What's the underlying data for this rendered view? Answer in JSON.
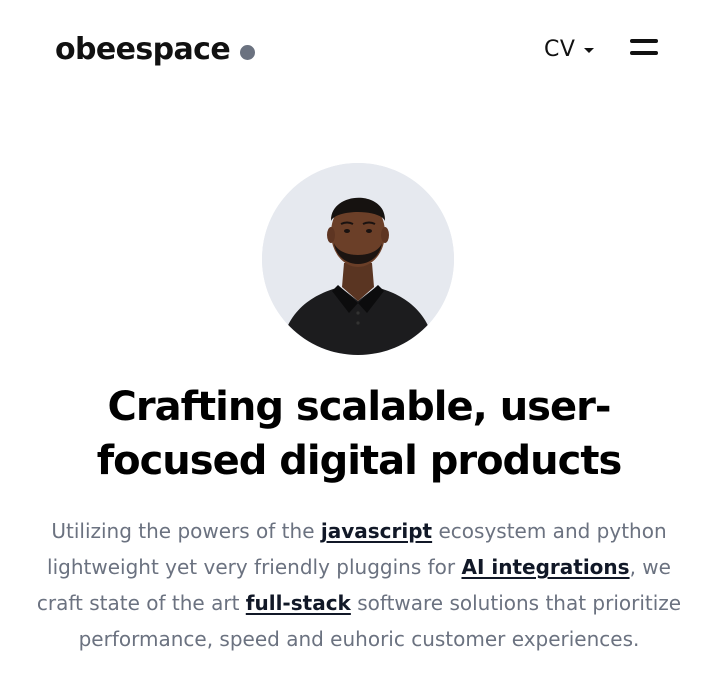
{
  "header": {
    "logo_text": "obeespace",
    "cv_label": "CV"
  },
  "hero": {
    "title": "Crafting scalable, user-focused digital products",
    "description": {
      "part1": "Utilizing the powers of the ",
      "link_javascript": "javascript",
      "part2": " ecosystem and python lightweight yet very friendly pluggins for ",
      "link_ai": "AI integrations",
      "part3": ", we craft state of the art ",
      "link_fullstack": "full-stack",
      "part4": " software solutions that prioritize performance, speed and euhoric customer experiences."
    }
  },
  "icons": {
    "logo_dot": "dot-icon",
    "dropdown": "chevron-down-icon",
    "menu": "menu-icon"
  },
  "colors": {
    "logo_dot": "#6b7280",
    "text_primary": "#111111",
    "text_muted": "#6b7280",
    "link": "#111827",
    "background": "#ffffff"
  }
}
